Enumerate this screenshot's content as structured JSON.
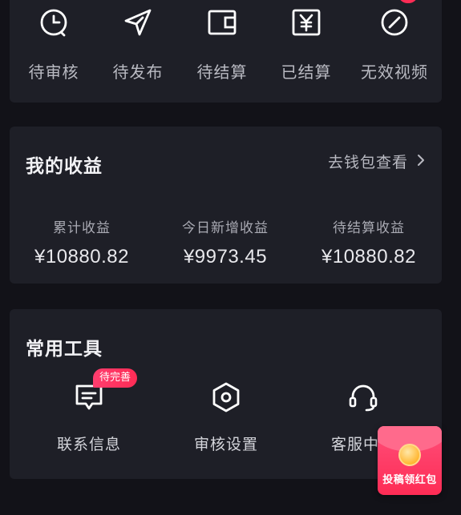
{
  "status": {
    "items": [
      {
        "label": "待审核",
        "icon": "clock-icon"
      },
      {
        "label": "待发布",
        "icon": "send-icon"
      },
      {
        "label": "待结算",
        "icon": "wallet-icon"
      },
      {
        "label": "已结算",
        "icon": "yen-icon"
      },
      {
        "label": "无效视频",
        "icon": "invalid-icon",
        "badge": "!"
      }
    ]
  },
  "income": {
    "title": "我的收益",
    "wallet_link": "去钱包查看",
    "metrics": [
      {
        "label": "累计收益",
        "value": "¥10880.82"
      },
      {
        "label": "今日新增收益",
        "value": "¥9973.45"
      },
      {
        "label": "待结算收益",
        "value": "¥10880.82"
      }
    ]
  },
  "tools": {
    "title": "常用工具",
    "items": [
      {
        "label": "联系信息",
        "icon": "contact-icon",
        "tag": "待完善"
      },
      {
        "label": "审核设置",
        "icon": "settings-hex-icon"
      },
      {
        "label": "客服中心",
        "icon": "headset-icon"
      }
    ]
  },
  "float_packet": {
    "label": "投稿领红包"
  },
  "colors": {
    "background": "#121218",
    "card": "#1e1f27",
    "accent": "#fe2c55",
    "text": "#e6e6ea"
  }
}
